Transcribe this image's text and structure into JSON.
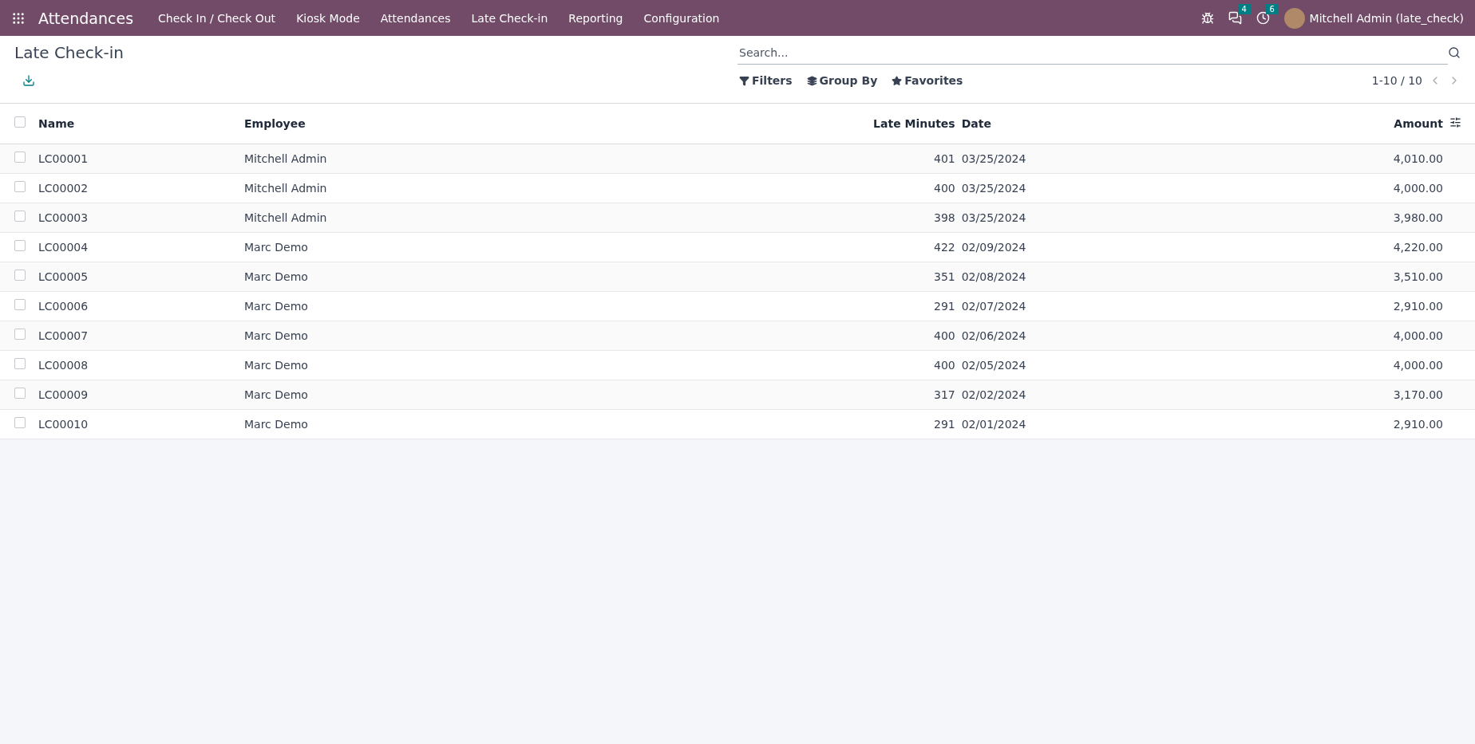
{
  "navbar": {
    "app": "Attendances",
    "menu": [
      "Check In / Check Out",
      "Kiosk Mode",
      "Attendances",
      "Late Check-in",
      "Reporting",
      "Configuration"
    ],
    "messages_count": "4",
    "activities_count": "6",
    "user": "Mitchell Admin (late_check)"
  },
  "page": {
    "title": "Late Check-in"
  },
  "search": {
    "placeholder": "Search..."
  },
  "filters": [
    "Filters",
    "Group By",
    "Favorites"
  ],
  "pager": "1-10 / 10",
  "table": {
    "select_all_checked": false,
    "columns": [
      "Name",
      "Employee",
      "Late Minutes",
      "Date",
      "Amount"
    ],
    "rows": [
      {
        "name": "LC00001",
        "employee": "Mitchell Admin",
        "late_minutes": "401",
        "date": "03/25/2024",
        "amount": "4,010.00",
        "checked": false
      },
      {
        "name": "LC00002",
        "employee": "Mitchell Admin",
        "late_minutes": "400",
        "date": "03/25/2024",
        "amount": "4,000.00",
        "checked": false
      },
      {
        "name": "LC00003",
        "employee": "Mitchell Admin",
        "late_minutes": "398",
        "date": "03/25/2024",
        "amount": "3,980.00",
        "checked": false
      },
      {
        "name": "LC00004",
        "employee": "Marc Demo",
        "late_minutes": "422",
        "date": "02/09/2024",
        "amount": "4,220.00",
        "checked": false
      },
      {
        "name": "LC00005",
        "employee": "Marc Demo",
        "late_minutes": "351",
        "date": "02/08/2024",
        "amount": "3,510.00",
        "checked": false
      },
      {
        "name": "LC00006",
        "employee": "Marc Demo",
        "late_minutes": "291",
        "date": "02/07/2024",
        "amount": "2,910.00",
        "checked": false
      },
      {
        "name": "LC00007",
        "employee": "Marc Demo",
        "late_minutes": "400",
        "date": "02/06/2024",
        "amount": "4,000.00",
        "checked": false
      },
      {
        "name": "LC00008",
        "employee": "Marc Demo",
        "late_minutes": "400",
        "date": "02/05/2024",
        "amount": "4,000.00",
        "checked": false
      },
      {
        "name": "LC00009",
        "employee": "Marc Demo",
        "late_minutes": "317",
        "date": "02/02/2024",
        "amount": "3,170.00",
        "checked": false
      },
      {
        "name": "LC00010",
        "employee": "Marc Demo",
        "late_minutes": "291",
        "date": "02/01/2024",
        "amount": "2,910.00",
        "checked": false
      }
    ]
  }
}
